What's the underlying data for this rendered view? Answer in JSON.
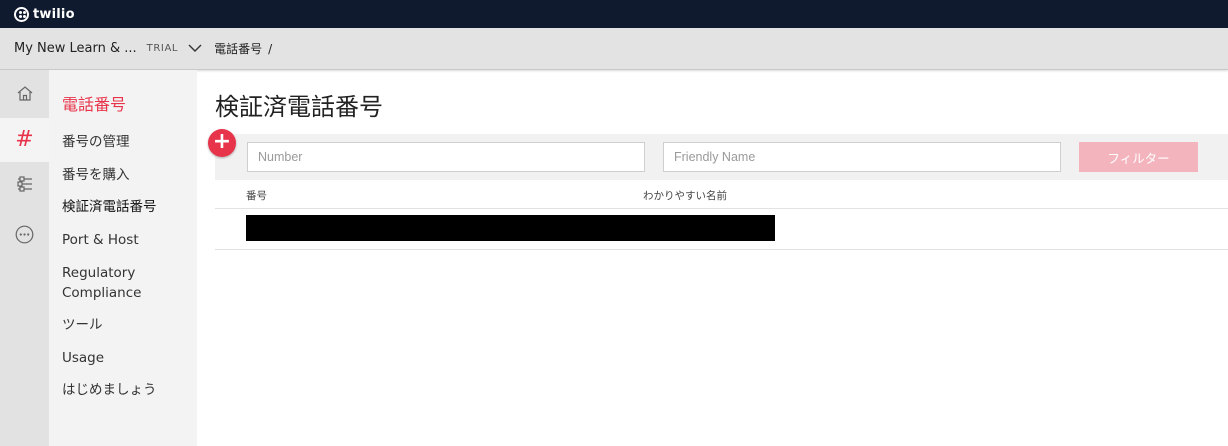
{
  "brand": {
    "name": "twilio"
  },
  "account": {
    "name": "My New Learn & ...",
    "badge": "TRIAL",
    "breadcrumb": "電話番号",
    "breadcrumb_sep": "/"
  },
  "rail": {
    "items": [
      {
        "icon": "home-icon"
      },
      {
        "icon": "hash-icon",
        "label": "#",
        "active": true
      },
      {
        "icon": "sliders-icon"
      },
      {
        "icon": "more-icon"
      }
    ]
  },
  "subnav": {
    "title": "電話番号",
    "items": [
      {
        "label": "番号の管理"
      },
      {
        "label": "番号を購入"
      },
      {
        "label": "検証済電話番号",
        "active": true
      },
      {
        "label": "Port & Host"
      },
      {
        "label": "Regulatory Compliance"
      },
      {
        "label": "ツール"
      },
      {
        "label": "Usage"
      },
      {
        "label": "はじめましょう"
      }
    ]
  },
  "main": {
    "title": "検証済電話番号",
    "add_label": "+",
    "filters": {
      "number_placeholder": "Number",
      "friendly_placeholder": "Friendly Name",
      "button_label": "フィルター"
    },
    "table": {
      "columns": [
        "番号",
        "わかりやすい名前"
      ],
      "rows": [
        {
          "redacted": true
        }
      ]
    }
  },
  "colors": {
    "accent": "#e8344a",
    "topbar": "#0f1a2e",
    "filter_button": "#f3b4bd"
  }
}
